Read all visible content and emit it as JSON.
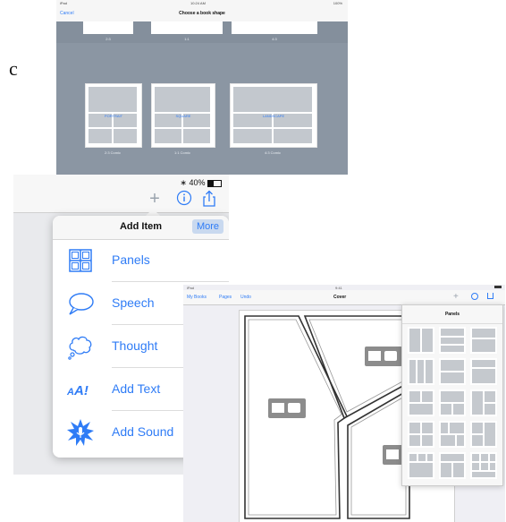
{
  "stray_letter": "c",
  "book_shape": {
    "status_left": "iPad",
    "status_time": "10:24 AM",
    "status_right": "100%",
    "cancel_label": "Cancel",
    "title": "Choose a book shape",
    "top_ratios": [
      "2:3",
      "1:1",
      "4:3"
    ],
    "shapes": [
      {
        "label": "PORTRAIT",
        "caption": "2:3 Comic"
      },
      {
        "label": "SQUARE",
        "caption": "1:1 Comic"
      },
      {
        "label": "LANDSCAPE",
        "caption": "4:3 Comic"
      }
    ]
  },
  "add_item": {
    "status": "40%",
    "status_icons": [
      "bluetooth-icon",
      "battery-icon"
    ],
    "toolbar_icons": [
      "plus-icon",
      "info-icon",
      "share-icon"
    ],
    "title": "Add Item",
    "more_label": "More",
    "items": [
      {
        "label": "Panels",
        "icon": "panels-icon"
      },
      {
        "label": "Speech",
        "icon": "speech-bubble-icon"
      },
      {
        "label": "Thought",
        "icon": "thought-bubble-icon"
      },
      {
        "label": "Add Text",
        "icon": "text-aa-icon"
      },
      {
        "label": "Add Sound",
        "icon": "sound-burst-icon"
      }
    ]
  },
  "panels_screen": {
    "status_left": "iPad",
    "status_time": "9:41",
    "nav_links": [
      "My Books",
      "Pages",
      "Undo"
    ],
    "title": "Cover",
    "popover_title": "Panels"
  },
  "colors": {
    "accent": "#2f7cf6",
    "book_bg": "#8b96a3",
    "panel_gray": "#c5c9ce"
  }
}
